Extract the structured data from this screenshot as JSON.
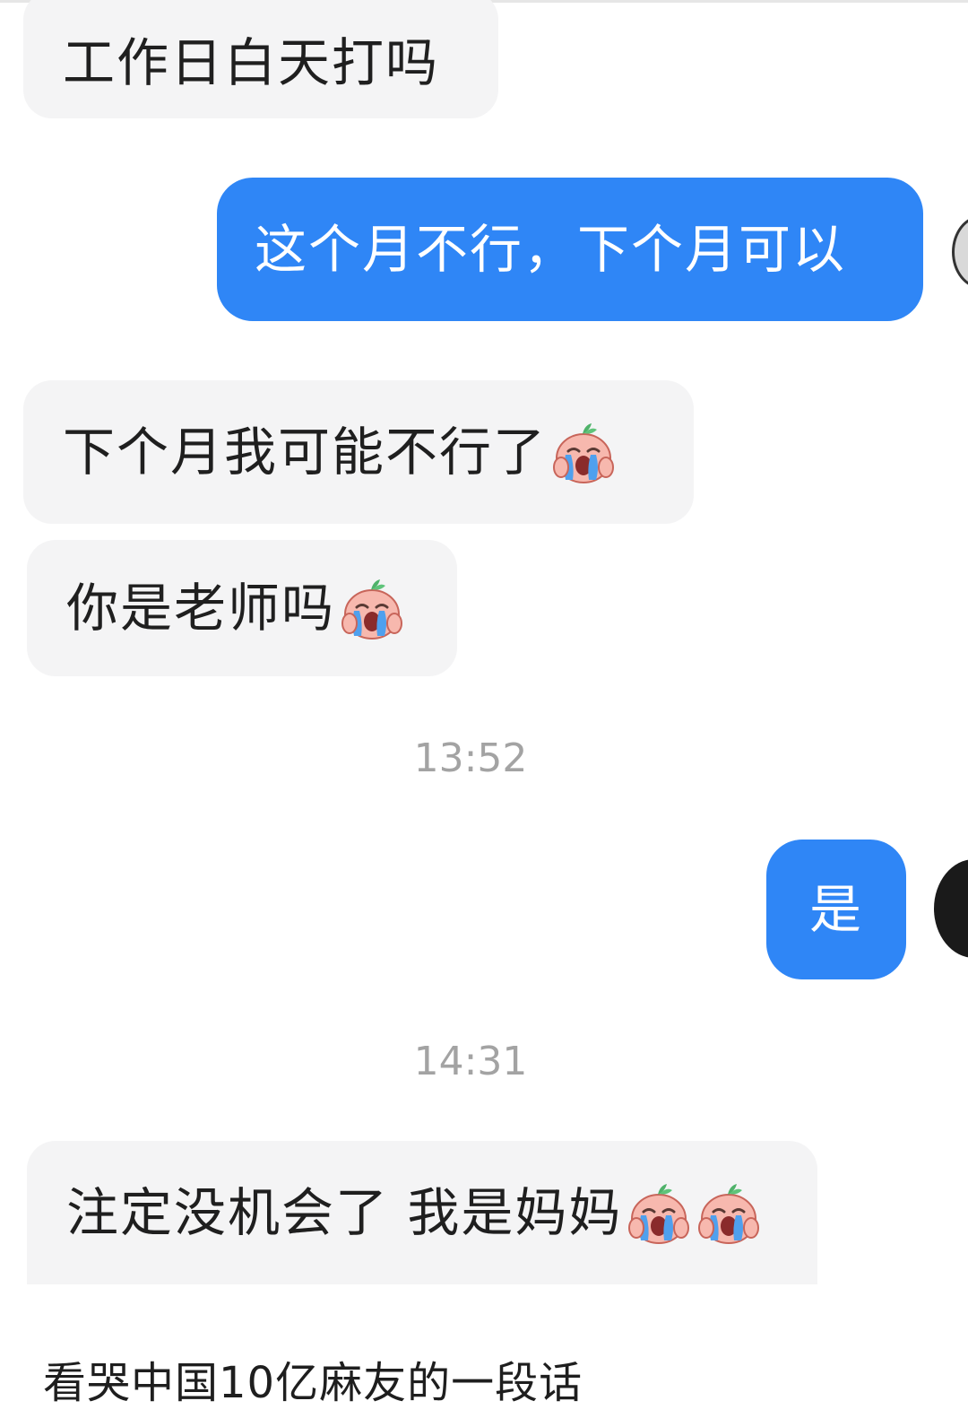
{
  "messages": [
    {
      "text": "工作日白天打吗",
      "emoji_count": 0
    },
    {
      "text": "这个月不行，下个月可以"
    },
    {
      "text": "下个月我可能不行了",
      "emoji": "crying-emoji",
      "emoji_count": 1
    },
    {
      "text": "你是老师吗",
      "emoji": "crying-emoji",
      "emoji_count": 1
    },
    {
      "text": "是"
    },
    {
      "text": "注定没机会了 我是妈妈",
      "emoji": "crying-emoji",
      "emoji_count": 2
    }
  ],
  "timestamps": [
    "13:52",
    "14:31"
  ],
  "caption": "看哭中国10亿麻友的一段话",
  "colors": {
    "incoming_bubble": "#f4f4f5",
    "outgoing_bubble": "#2f86f6",
    "timestamp_text": "#a3a3a3"
  }
}
